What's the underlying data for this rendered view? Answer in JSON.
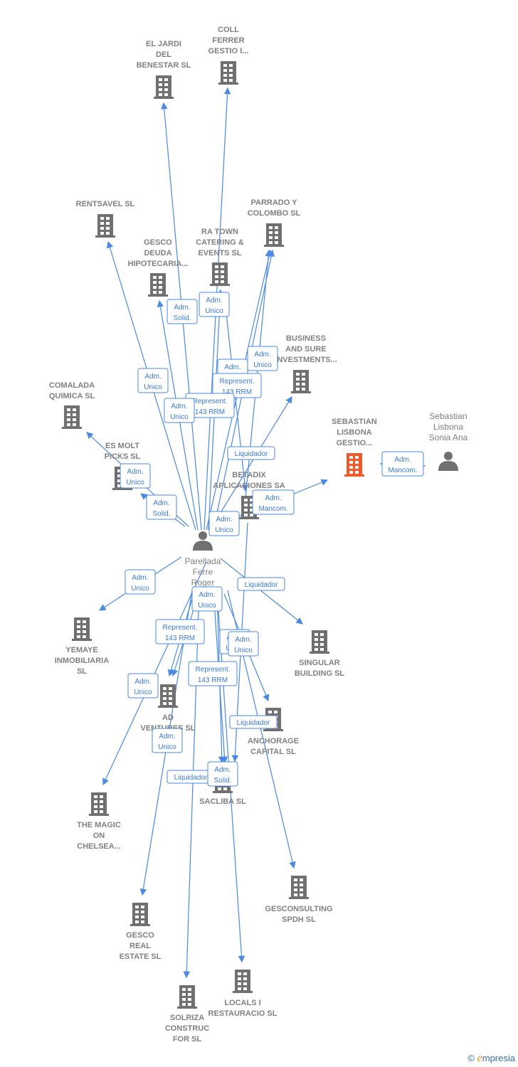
{
  "colors": {
    "edge": "#4a8ae0",
    "node": "#707070",
    "highlight": "#f05a28"
  },
  "nodes": [
    {
      "type": "company",
      "lines": [
        "EL JARDI",
        "DEL",
        "BENESTAR SL"
      ]
    },
    {
      "type": "company",
      "lines": [
        "COLL",
        "FERRER",
        "GESTIO I..."
      ]
    },
    {
      "type": "company",
      "lines": [
        "RENTSAVEL SL"
      ]
    },
    {
      "type": "company",
      "lines": [
        "PARRADO Y",
        "COLOMBO  SL"
      ]
    },
    {
      "type": "company",
      "lines": [
        "GESCO",
        "DEUDA",
        "HIPOTECARIA..."
      ]
    },
    {
      "type": "company",
      "lines": [
        "RA TOWN",
        "CATERING &",
        "EVENTS SL"
      ]
    },
    {
      "type": "company",
      "lines": [
        "BUSINESS",
        "AND SURE",
        "INVESTMENTS..."
      ]
    },
    {
      "type": "company",
      "lines": [
        "COMALADA",
        "QUIMICA SL"
      ]
    },
    {
      "type": "company",
      "lines": [
        "ES MOLT",
        "PICKS  SL"
      ]
    },
    {
      "type": "company",
      "highlight": true,
      "lines": [
        "SEBASTIAN",
        "LISBONA",
        "GESTIO..."
      ]
    },
    {
      "type": "person",
      "lines": [
        "Sebastian",
        "Lisbona",
        "Sonia Ana"
      ]
    },
    {
      "type": "company",
      "lines": [
        "BETADIX",
        "APLICACIONES SA"
      ]
    },
    {
      "type": "person",
      "lines": [
        "Parellada",
        "Ferre",
        "Roger"
      ]
    },
    {
      "type": "company",
      "lines": [
        "YEMAYE",
        "INMOBILIARIA",
        "SL"
      ]
    },
    {
      "type": "company",
      "lines": [
        "SINGULAR",
        "BUILDING SL"
      ]
    },
    {
      "type": "company",
      "lines": [
        "AD",
        "VENTURES  SL"
      ]
    },
    {
      "type": "company",
      "lines": [
        "ANCHORAGE",
        "CAPITAL  SL"
      ]
    },
    {
      "type": "company",
      "lines": [
        "SACLIBA  SL"
      ]
    },
    {
      "type": "company",
      "lines": [
        "THE MAGIC",
        "ON",
        "CHELSEA..."
      ]
    },
    {
      "type": "company",
      "lines": [
        "GESCONSULTING",
        "SPDH SL"
      ]
    },
    {
      "type": "company",
      "lines": [
        "GESCO",
        "REAL",
        "ESTATE  SL"
      ]
    },
    {
      "type": "company",
      "lines": [
        "LOCALS I",
        "RESTAURACIO SL"
      ]
    },
    {
      "type": "company",
      "lines": [
        "SOLRIZA",
        "CONSTRUC",
        "FOR SL"
      ]
    }
  ],
  "edge_labels": [
    [
      "Adm.",
      "Solid."
    ],
    [
      "Adm.",
      "Unico"
    ],
    [
      "Adm.",
      "Unico"
    ],
    [
      "Adm.",
      "Unico"
    ],
    [
      "Represent.",
      "143 RRM"
    ],
    [
      "Adm.",
      "Unico"
    ],
    [
      "Represent.",
      "143 RRM"
    ],
    [
      "Adm.",
      "Unico"
    ],
    [
      "Liquidador"
    ],
    [
      "Adm.",
      "Unico"
    ],
    [
      "Adm.",
      "Solid."
    ],
    [
      "Adm.",
      "Mancom."
    ],
    [
      "Adm.",
      "Unico"
    ],
    [
      "Adm.",
      "Mancom."
    ],
    [
      "Adm.",
      "Unico"
    ],
    [
      "Liquidador"
    ],
    [
      "Adm.",
      "Unico"
    ],
    [
      "Represent.",
      "143 RRM"
    ],
    [
      "Adm.",
      "Unico"
    ],
    [
      "Adm.",
      "Unico"
    ],
    [
      "Represent.",
      "143 RRM"
    ],
    [
      "Adm.",
      "Unico"
    ],
    [
      "Adm.",
      "Unico"
    ],
    [
      "Liquidador"
    ],
    [
      "Liquidador"
    ],
    [
      "Adm.",
      "Solid."
    ]
  ],
  "footer": {
    "copyright": "©",
    "brand": "mpresia",
    "brand_initial": "e"
  }
}
